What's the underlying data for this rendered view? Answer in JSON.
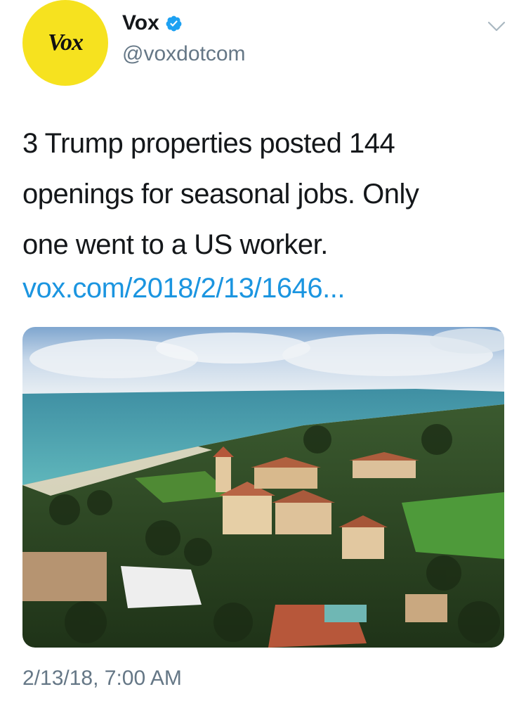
{
  "account": {
    "avatar_text": "Vox",
    "display_name": "Vox",
    "handle": "@voxdotcom",
    "verified": true
  },
  "tweet": {
    "lines": [
      "3 Trump properties posted 144",
      "openings for seasonal jobs. Only",
      "one went to a US worker."
    ],
    "link": "vox.com/2018/2/13/1646...",
    "timestamp": "2/13/18, 7:00 AM"
  },
  "media": {
    "description_icon": "aerial-photo"
  },
  "colors": {
    "avatar_bg": "#f6e21f",
    "link": "#1b95e0",
    "secondary_text": "#657786",
    "verified": "#1da1f2"
  },
  "icons": {
    "verified": "verified-badge-icon",
    "menu": "chevron-down-icon"
  }
}
